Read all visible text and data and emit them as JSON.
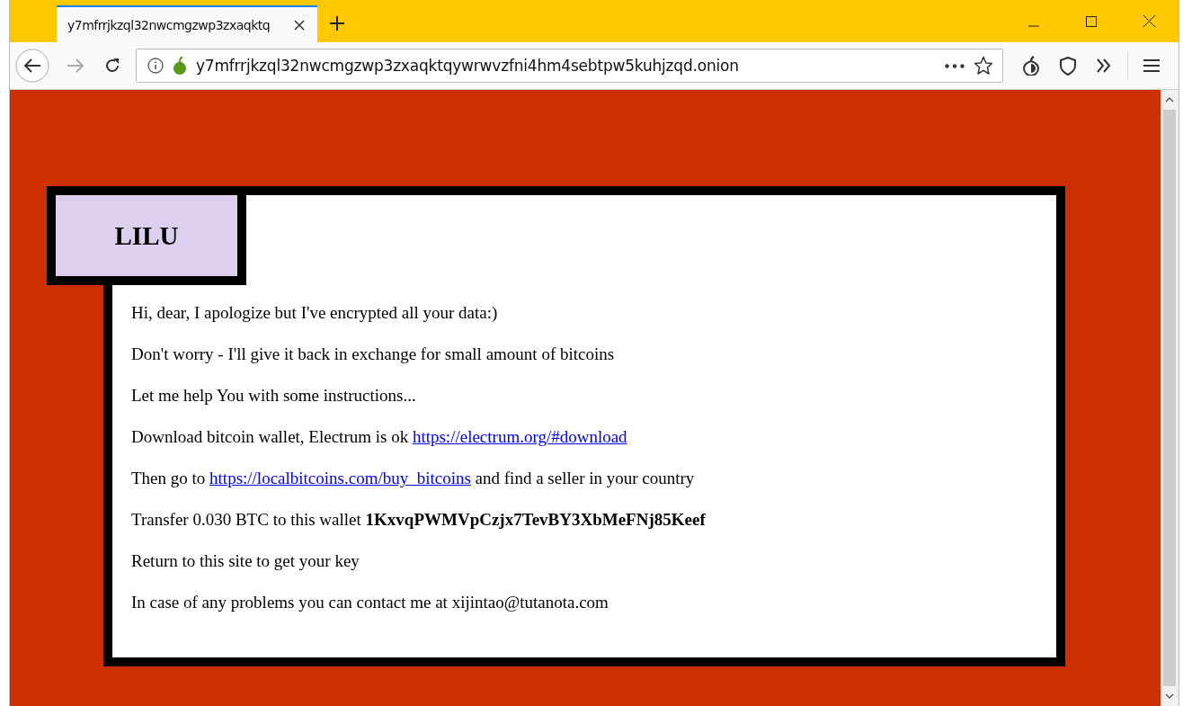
{
  "tab": {
    "title": "y7mfrrjkzql32nwcmgzwp3zxaqktq",
    "selected": true
  },
  "address": {
    "value": "y7mfrrjkzql32nwcmgzwp3zxaqktqywrwvzfni4hm4sebtpw5kuhjzqd.onion"
  },
  "logo": {
    "text": "LILU"
  },
  "paragraphs": [
    {
      "before": "Hi, dear, I apologize but I've encrypted all your data:)"
    },
    {
      "before": "Don't worry - I'll give it back in exchange for small amount of bitcoins"
    },
    {
      "before": "Let me help You with some instructions..."
    },
    {
      "before": "Download bitcoin wallet, Electrum is ok ",
      "link": "https://electrum.org/#download"
    },
    {
      "before": "Then go to ",
      "link": "https://localbitcoins.com/buy_bitcoins",
      "after": " and find a seller in your country"
    },
    {
      "before": "Transfer 0.030 BTC to this wallet **1KxvqPWMVpCzjx7TevBY3XbMeFNj85Keef**"
    },
    {
      "before": "Return to this site to get your key"
    },
    {
      "before": "In case of any problems you can contact me at xijintao@tutanota.com"
    }
  ]
}
